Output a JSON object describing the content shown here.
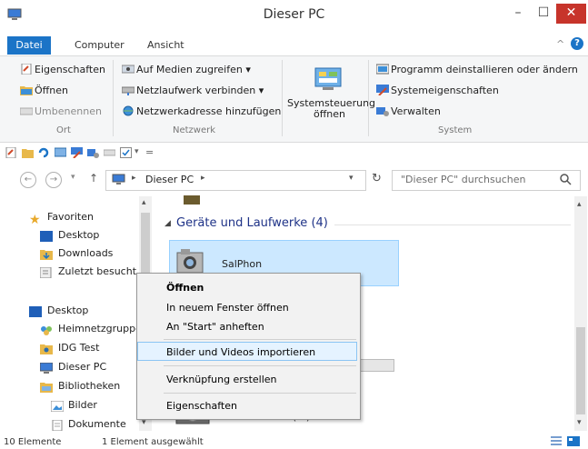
{
  "window": {
    "title": "Dieser PC",
    "minimize": "–",
    "maximize": "☐",
    "close": "✕"
  },
  "menu_tabs": [
    "Datei",
    "Computer",
    "Ansicht"
  ],
  "ribbon": {
    "ort": {
      "label": "Ort",
      "items": [
        "Eigenschaften",
        "Öffnen",
        "Umbenennen"
      ]
    },
    "netzwerk": {
      "label": "Netzwerk",
      "items": [
        "Auf Medien zugreifen ▾",
        "Netzlaufwerk verbinden ▾",
        "Netzwerkadresse hinzufügen"
      ]
    },
    "systemsteuerung": {
      "line1": "Systemsteuerung",
      "line2": "öffnen"
    },
    "system": {
      "label": "System",
      "items": [
        "Programm deinstallieren oder ändern",
        "Systemeigenschaften",
        "Verwalten"
      ]
    }
  },
  "address": {
    "path": "Dieser PC",
    "search_placeholder": "\"Dieser PC\" durchsuchen"
  },
  "nav": {
    "favorites_label": "Favoriten",
    "favorites": [
      "Desktop",
      "Downloads",
      "Zuletzt besucht"
    ],
    "tree": [
      "Desktop",
      "Heimnetzgruppe",
      "IDG Test",
      "Dieser PC",
      "Bibliotheken",
      "Bilder",
      "Dokumente"
    ]
  },
  "content": {
    "group_title": "Geräte und Laufwerke (4)",
    "tile_label": "SalPhon",
    "drive_label": "DVD-Laufwerk (E:)"
  },
  "context_menu": [
    "Öffnen",
    "In neuem Fenster öffnen",
    "An \"Start\" anheften",
    "Bilder und Videos importieren",
    "Verknüpfung erstellen",
    "Eigenschaften"
  ],
  "status": {
    "count": "10 Elemente",
    "selected": "1 Element ausgewählt"
  },
  "colors": {
    "accent": "#1b74c7",
    "close": "#c7342b",
    "selection": "#cce8ff"
  }
}
